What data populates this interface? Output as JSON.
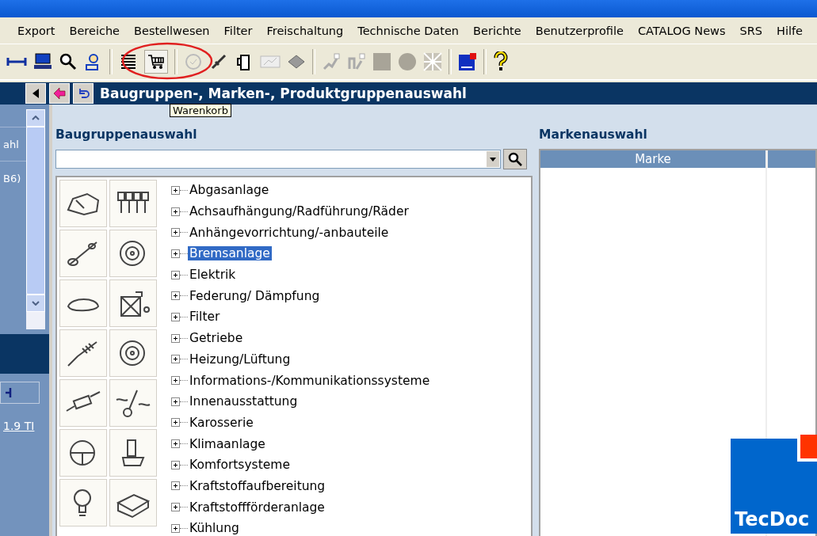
{
  "menu": [
    "Export",
    "Bereiche",
    "Bestellwesen",
    "Filter",
    "Freischaltung",
    "Technische Daten",
    "Berichte",
    "Benutzerprofile",
    "CATALOG News",
    "SRS",
    "Hilfe"
  ],
  "tooltip": "Warenkorb",
  "header": {
    "title": "Baugruppen-, Marken-, Produktgruppenauswahl"
  },
  "left_panel": {
    "item": "ahl",
    "text": "B6)",
    "link": "1.9 TI"
  },
  "baugruppen": {
    "heading": "Baugruppenauswahl",
    "tree": [
      {
        "label": "Abgasanlage",
        "expanded": false,
        "selected": false
      },
      {
        "label": "Achsaufhängung/Radführung/Räder",
        "expanded": false,
        "selected": false
      },
      {
        "label": "Anhängevorrichtung/-anbauteile",
        "expanded": false,
        "selected": false
      },
      {
        "label": "Bremsanlage",
        "expanded": false,
        "selected": true
      },
      {
        "label": "Elektrik",
        "expanded": false,
        "selected": false
      },
      {
        "label": "Federung/ Dämpfung",
        "expanded": false,
        "selected": false
      },
      {
        "label": "Filter",
        "expanded": false,
        "selected": false
      },
      {
        "label": "Getriebe",
        "expanded": false,
        "selected": false
      },
      {
        "label": "Heizung/Lüftung",
        "expanded": false,
        "selected": false
      },
      {
        "label": "Informations-/Kommunikationssysteme",
        "expanded": false,
        "selected": false
      },
      {
        "label": "Innenausstattung",
        "expanded": false,
        "selected": false
      },
      {
        "label": "Karosserie",
        "expanded": false,
        "selected": false
      },
      {
        "label": "Klimaanlage",
        "expanded": false,
        "selected": false
      },
      {
        "label": "Komfortsysteme",
        "expanded": false,
        "selected": false
      },
      {
        "label": "Kraftstoffaufbereitung",
        "expanded": false,
        "selected": false
      },
      {
        "label": "Kraftstoffförderanlage",
        "expanded": false,
        "selected": false
      },
      {
        "label": "Kühlung",
        "expanded": false,
        "selected": false
      }
    ]
  },
  "marken": {
    "heading": "Markenauswahl",
    "columns": [
      "Marke"
    ]
  },
  "logo": "TecDoc"
}
